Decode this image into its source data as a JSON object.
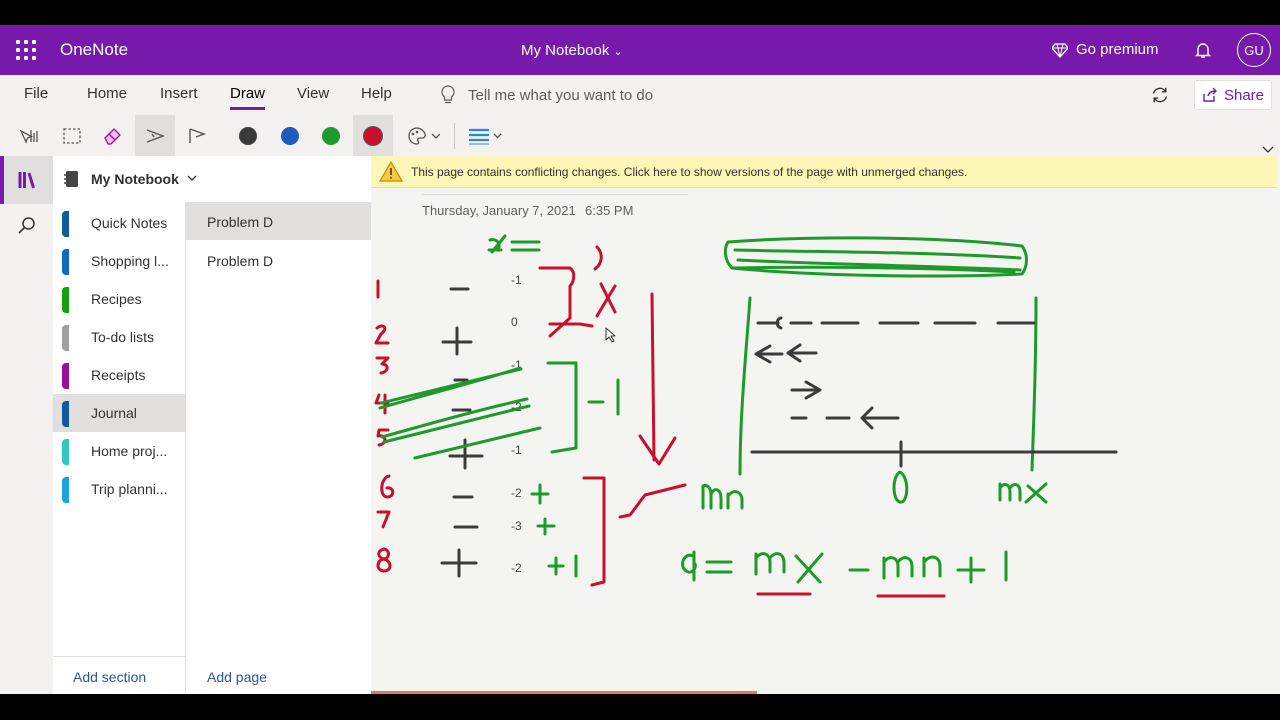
{
  "app": {
    "name": "OneNote",
    "notebook_title": "My Notebook",
    "premium_label": "Go premium",
    "avatar_initials": "GU"
  },
  "menu": {
    "items": [
      "File",
      "Home",
      "Insert",
      "Draw",
      "View",
      "Help"
    ],
    "active": "Draw",
    "tell_me": "Tell me what you want to do",
    "share_label": "Share"
  },
  "toolbar": {
    "pen_colors": [
      "#3b3b3b",
      "#1f5bbf",
      "#1e9a2c",
      "#c8102e"
    ]
  },
  "notebook": {
    "name": "My Notebook"
  },
  "sections": [
    {
      "label": "Quick Notes",
      "color": "#0f5b9c"
    },
    {
      "label": "Shopping l...",
      "color": "#0f6cbd"
    },
    {
      "label": "Recipes",
      "color": "#13a10e"
    },
    {
      "label": "To-do lists",
      "color": "#a19f9d"
    },
    {
      "label": "Receipts",
      "color": "#9c0f9c"
    },
    {
      "label": "Journal",
      "color": "#0f5b9c"
    },
    {
      "label": "Home proj...",
      "color": "#2fc9c0"
    },
    {
      "label": "Trip planni...",
      "color": "#1aa6d8"
    }
  ],
  "pages": [
    {
      "label": "Problem D"
    },
    {
      "label": "Problem D"
    }
  ],
  "add_section_label": "Add section",
  "add_page_label": "Add page",
  "banner": {
    "text": "This page contains conflicting changes. Click here to show versions of the page with unmerged changes."
  },
  "page": {
    "date": "Thursday, January 7, 2021",
    "time": "6:35 PM"
  },
  "ink_numbers": [
    "-1",
    "0",
    "-1",
    "-2",
    "-1",
    "-2",
    "-3",
    "-2"
  ]
}
